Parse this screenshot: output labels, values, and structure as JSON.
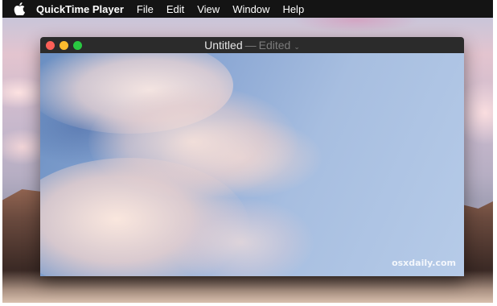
{
  "menubar": {
    "app_name": "QuickTime Player",
    "items": [
      "File",
      "Edit",
      "View",
      "Window",
      "Help"
    ]
  },
  "window": {
    "title": "Untitled",
    "separator": "—",
    "status": "Edited",
    "chevron": "⌄"
  },
  "video": {
    "watermark": "osxdaily.com"
  },
  "icons": {
    "apple": "apple-icon",
    "close": "close-button",
    "minimize": "minimize-button",
    "zoom": "zoom-button"
  },
  "colors": {
    "menubar_bg": "#141414",
    "titlebar_bg": "#2b2b2b",
    "close": "#fc5f57",
    "minimize": "#fdbc2e",
    "zoom": "#29c841"
  }
}
